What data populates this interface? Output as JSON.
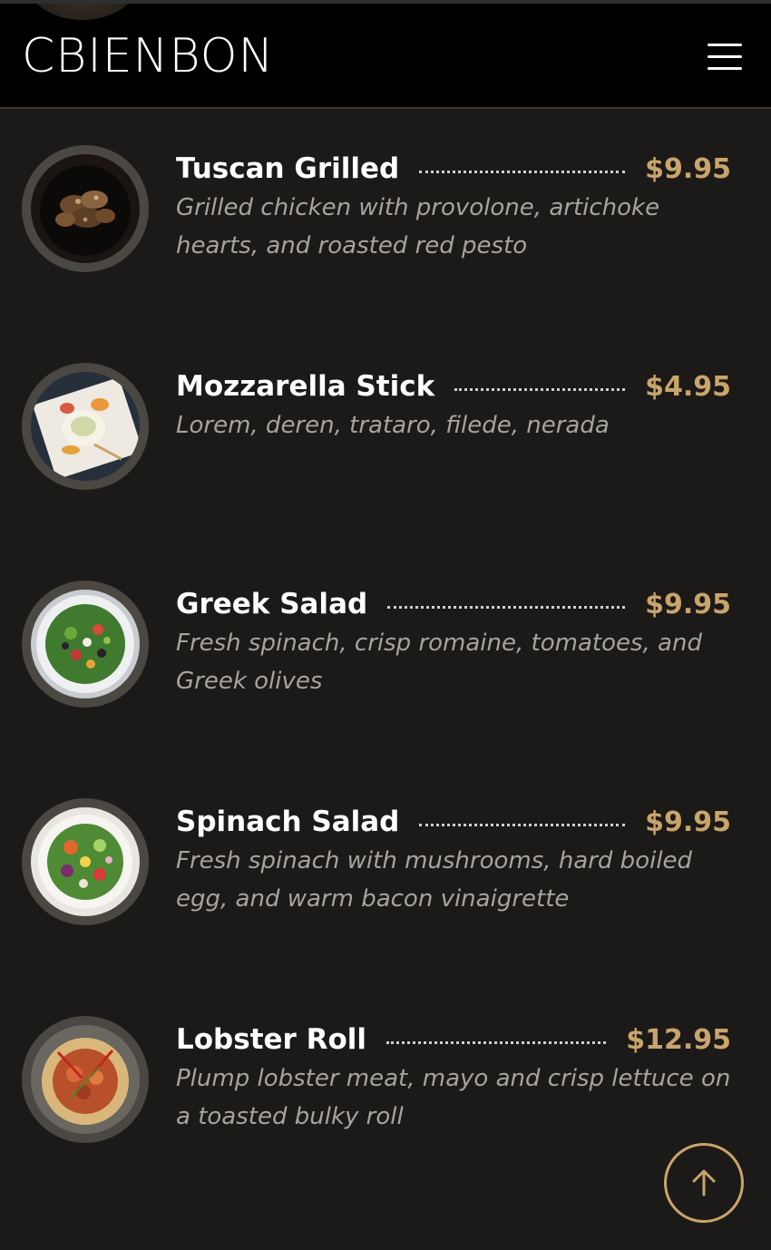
{
  "header": {
    "logo": "CBIENBON",
    "menu_icon": "hamburger-menu-icon"
  },
  "menu": {
    "items": [
      {
        "name": "Tuscan Grilled",
        "price": "$9.95",
        "description": "Grilled chicken with provolone, artichoke hearts, and roasted red pesto",
        "image_icon": "grilled-chicken-image"
      },
      {
        "name": "Mozzarella Stick",
        "price": "$4.95",
        "description": "Lorem, deren, trataro, filede, nerada",
        "image_icon": "mozzarella-plate-image"
      },
      {
        "name": "Greek Salad",
        "price": "$9.95",
        "description": "Fresh spinach, crisp romaine, tomatoes, and Greek olives",
        "image_icon": "greek-salad-image"
      },
      {
        "name": "Spinach Salad",
        "price": "$9.95",
        "description": "Fresh spinach with mushrooms, hard boiled egg, and warm bacon vinaigrette",
        "image_icon": "spinach-salad-image"
      },
      {
        "name": "Lobster Roll",
        "price": "$12.95",
        "description": "Plump lobster meat, mayo and crisp lettuce on a toasted bulky roll",
        "image_icon": "lobster-roll-image"
      }
    ]
  },
  "back_to_top_icon": "arrow-up-icon",
  "colors": {
    "background": "#1c1a18",
    "header": "#000000",
    "price_accent": "#c9a46b",
    "description": "#a7a39e"
  }
}
